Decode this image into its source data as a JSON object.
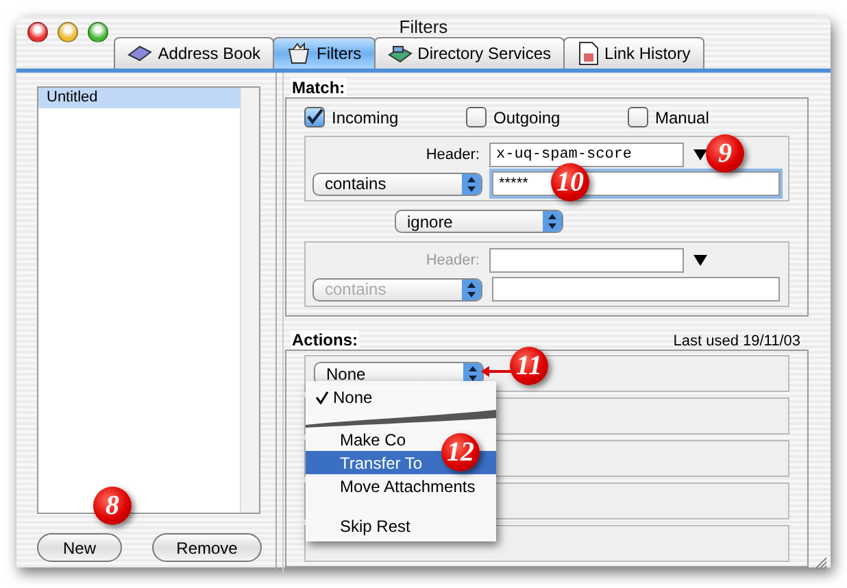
{
  "window": {
    "title": "Filters"
  },
  "tabs": [
    {
      "label": "Address Book",
      "selected": false
    },
    {
      "label": "Filters",
      "selected": true
    },
    {
      "label": "Directory Services",
      "selected": false
    },
    {
      "label": "Link History",
      "selected": false
    }
  ],
  "filter_list": {
    "items": [
      {
        "label": "Untitled",
        "selected": true
      }
    ]
  },
  "buttons": [
    {
      "label": "New"
    },
    {
      "label": "Remove"
    }
  ],
  "match": {
    "label": "Match:",
    "sources": [
      {
        "label": "Incoming",
        "checked": true
      },
      {
        "label": "Outgoing",
        "checked": false
      },
      {
        "label": "Manual",
        "checked": false
      }
    ],
    "condition_1": {
      "header_label": "Header:",
      "header_value": "x-uq-spam-score",
      "operator": "contains",
      "value": "*****",
      "disabled": false
    },
    "combinator": "ignore",
    "condition_2": {
      "header_label": "Header:",
      "operator": "contains",
      "disabled": true
    }
  },
  "actions": {
    "label": "Actions:",
    "last_used": "Last used 19/11/03",
    "rows": [
      {
        "action": "None"
      }
    ]
  },
  "menu": {
    "items": [
      {
        "kind": "item",
        "label": "None",
        "checked": true,
        "selected": false
      },
      {
        "kind": "tear"
      },
      {
        "kind": "item",
        "label": "Make Co",
        "checked": false,
        "selected": false
      },
      {
        "kind": "item",
        "label": "Transfer To",
        "checked": false,
        "selected": true
      },
      {
        "kind": "item",
        "label": "Move Attachments",
        "checked": false,
        "selected": false
      },
      {
        "kind": "separator"
      },
      {
        "kind": "item",
        "label": "Skip Rest",
        "checked": false,
        "selected": false
      }
    ]
  },
  "callouts": [
    {
      "label": "8"
    },
    {
      "label": "9"
    },
    {
      "label": "10"
    },
    {
      "label": "11"
    },
    {
      "label": "12"
    }
  ]
}
